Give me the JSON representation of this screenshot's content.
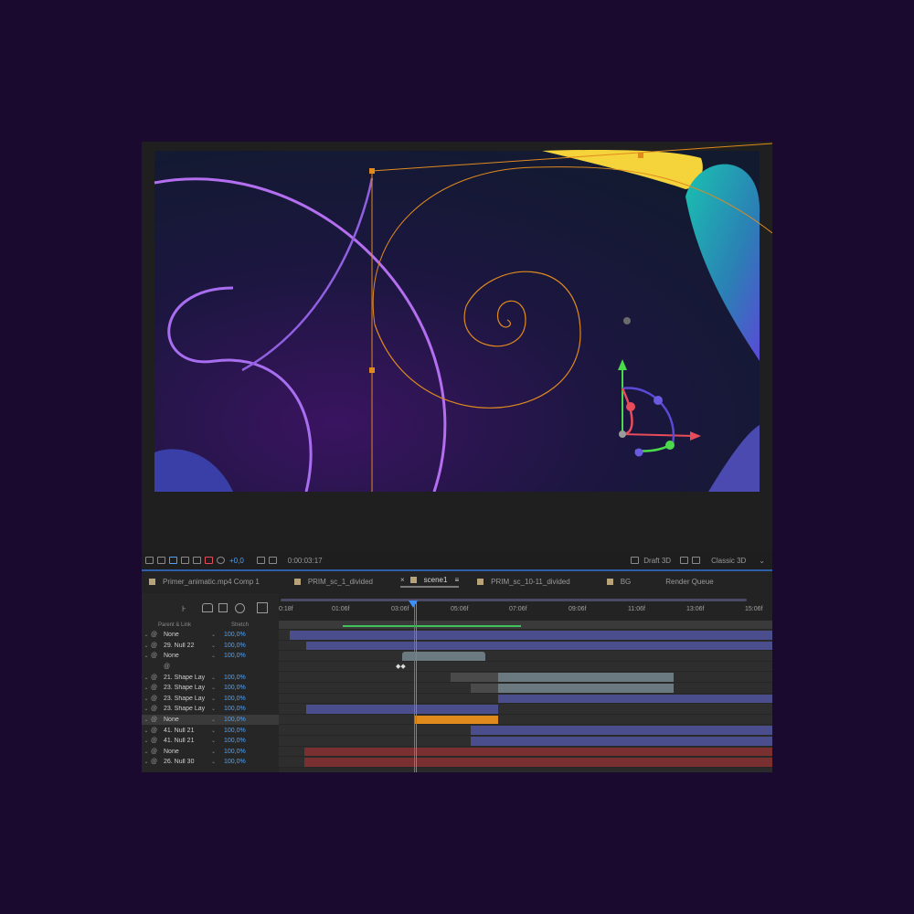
{
  "viewer": {
    "timecode": "0:00:03:17",
    "exposure": "+0,0",
    "renderer_label": "Draft 3D",
    "renderer_mode": "Classic 3D"
  },
  "tabs": [
    {
      "label": "Primer_animatic.mp4 Comp 1",
      "active": false
    },
    {
      "label": "PRIM_sc_1_divided",
      "active": false
    },
    {
      "label": "scene1",
      "active": true
    },
    {
      "label": "PRIM_sc_10-11_divided",
      "active": false
    },
    {
      "label": "BG",
      "active": false
    },
    {
      "label": "Render Queue",
      "active": false
    }
  ],
  "timeline": {
    "ruler_ticks": [
      "0:18f",
      "01:06f",
      "03:06f",
      "05:06f",
      "07:06f",
      "09:06f",
      "11:06f",
      "13:06f",
      "15:06f"
    ],
    "header": {
      "parent_link": "Parent & Link",
      "stretch": "Stretch"
    },
    "rows": [
      {
        "parent": "None",
        "stretch": "100,0%"
      },
      {
        "parent": "29. Null 22",
        "stretch": "100,0%"
      },
      {
        "parent": "None",
        "stretch": "100,0%"
      },
      {
        "parent": "",
        "stretch": ""
      },
      {
        "parent": "21. Shape Lay",
        "stretch": "100,0%"
      },
      {
        "parent": "23. Shape Lay",
        "stretch": "100,0%"
      },
      {
        "parent": "23. Shape Lay",
        "stretch": "100,0%"
      },
      {
        "parent": "23. Shape Lay",
        "stretch": "100,0%"
      },
      {
        "parent": "None",
        "stretch": "100,0%"
      },
      {
        "parent": "41. Null 21",
        "stretch": "100,0%"
      },
      {
        "parent": "41. Null 21",
        "stretch": "100,0%"
      },
      {
        "parent": "None",
        "stretch": "100,0%"
      },
      {
        "parent": "26. Null 30",
        "stretch": "100,0%"
      }
    ]
  },
  "colors": {
    "accent": "#3b8fff",
    "track_blue": "#4b4e8c",
    "track_gray": "#6b7a80",
    "track_orange": "#e08a1e",
    "track_red": "#7a3030",
    "stretch_text": "#4aa3ff"
  }
}
